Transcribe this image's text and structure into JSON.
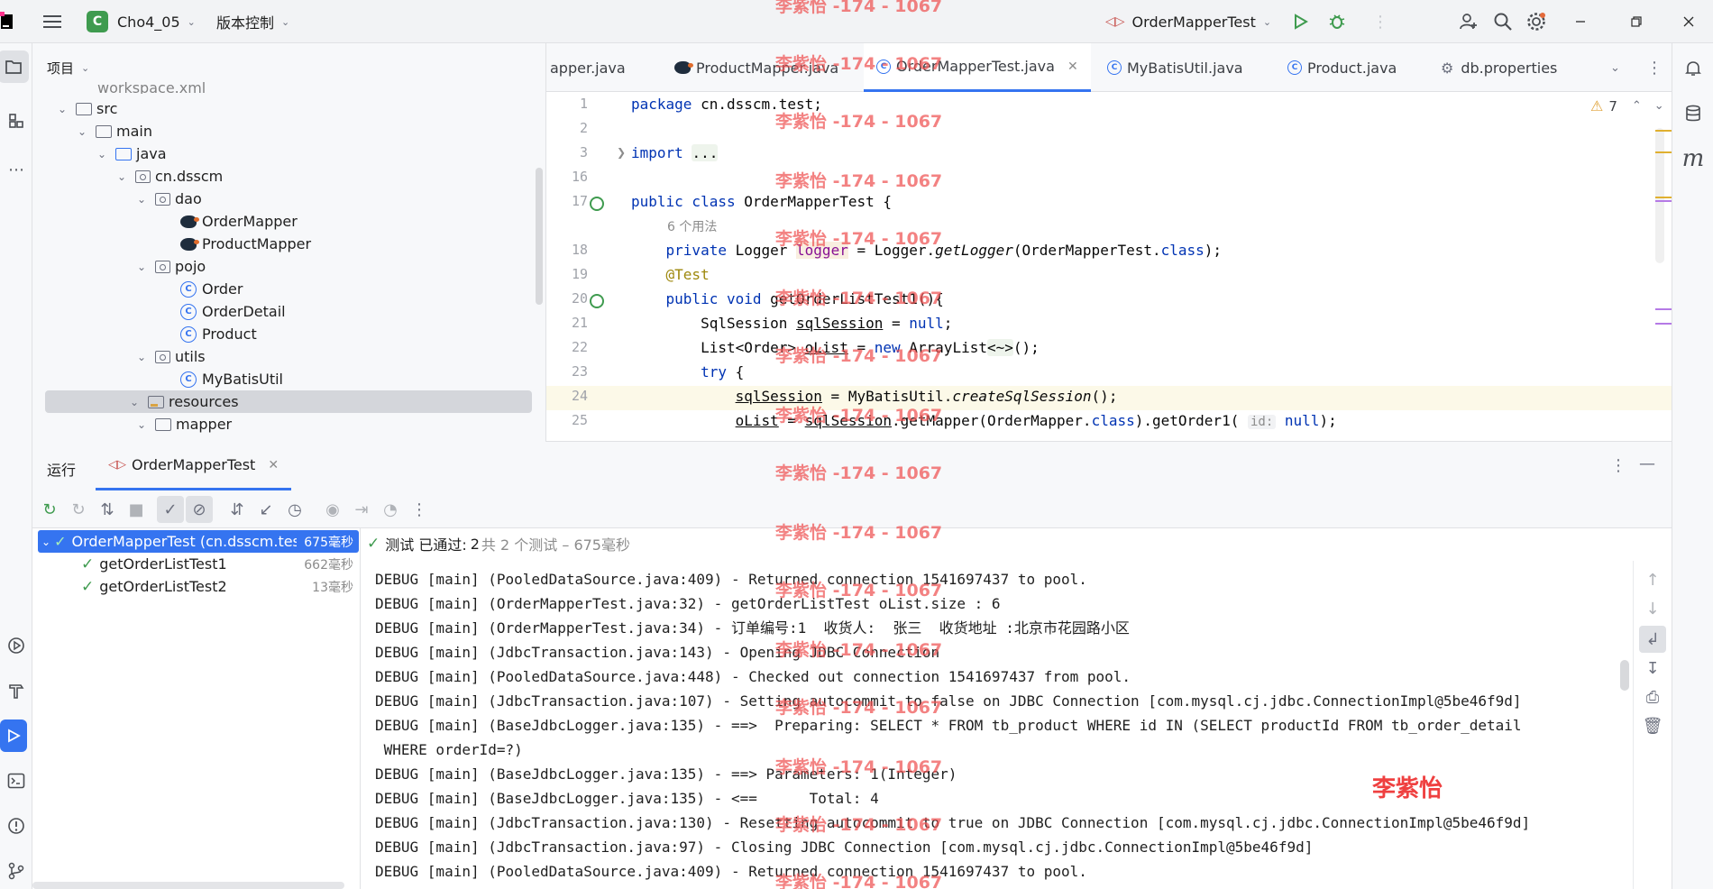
{
  "titlebar": {
    "project_badge": "C",
    "project_name": "Cho4_05",
    "vcs": "版本控制",
    "run_config": "OrderMapperTest"
  },
  "project_panel": {
    "title": "项目",
    "tree": [
      {
        "label": "workspace.xml",
        "icon": "file-icon"
      },
      {
        "label": "src",
        "icon": "folder-icon"
      },
      {
        "label": "main",
        "icon": "folder-icon"
      },
      {
        "label": "java",
        "icon": "folder-icon"
      },
      {
        "label": "cn.dsscm",
        "icon": "package-icon"
      },
      {
        "label": "dao",
        "icon": "package-icon"
      },
      {
        "label": "OrderMapper",
        "icon": "mapper-icon"
      },
      {
        "label": "ProductMapper",
        "icon": "mapper-icon"
      },
      {
        "label": "pojo",
        "icon": "package-icon"
      },
      {
        "label": "Order",
        "icon": "class-icon"
      },
      {
        "label": "OrderDetail",
        "icon": "class-icon"
      },
      {
        "label": "Product",
        "icon": "class-icon"
      },
      {
        "label": "utils",
        "icon": "package-icon"
      },
      {
        "label": "MyBatisUtil",
        "icon": "class-icon"
      },
      {
        "label": "resources",
        "icon": "resources-folder-icon"
      },
      {
        "label": "mapper",
        "icon": "folder-icon"
      }
    ]
  },
  "editor_tabs": [
    {
      "label": "apper.java"
    },
    {
      "label": "ProductMapper.java"
    },
    {
      "label": "OrderMapperTest.java",
      "active": true
    },
    {
      "label": "MyBatisUtil.java"
    },
    {
      "label": "Product.java"
    },
    {
      "label": "db.properties"
    }
  ],
  "editor": {
    "warnings": "7",
    "line_numbers": [
      "1",
      "2",
      "3",
      "16",
      "17",
      "",
      "18",
      "19",
      "20",
      "21",
      "22",
      "23",
      "24",
      "25"
    ],
    "usage_hint": "6 个用法",
    "folded": "...",
    "param_hint": "id:"
  },
  "run_panel": {
    "tab_run": "运行",
    "tab_config": "OrderMapperTest",
    "tests": [
      {
        "name": "OrderMapperTest (cn.dsscm.tes",
        "duration": "675毫秒"
      },
      {
        "name": "getOrderListTest1",
        "duration": "662毫秒"
      },
      {
        "name": "getOrderListTest2",
        "duration": "13毫秒"
      }
    ],
    "status_label": "测试 已通过:",
    "status_count": "2",
    "status_detail": "共 2 个测试 – 675毫秒",
    "console": [
      "DEBUG [main] (PooledDataSource.java:409) - Returned connection 1541697437 to pool.",
      "DEBUG [main] (OrderMapperTest.java:32) - getOrderListTest oList.size : 6",
      "DEBUG [main] (OrderMapperTest.java:34) - 订单编号:1  收货人:  张三  收货地址 :北京市花园路小区",
      "DEBUG [main] (JdbcTransaction.java:143) - Opening JDBC Connection",
      "DEBUG [main] (PooledDataSource.java:448) - Checked out connection 1541697437 from pool.",
      "DEBUG [main] (JdbcTransaction.java:107) - Setting autocommit to false on JDBC Connection [com.mysql.cj.jdbc.ConnectionImpl@5be46f9d]",
      "DEBUG [main] (BaseJdbcLogger.java:135) - ==>  Preparing: SELECT * FROM tb_product WHERE id IN (SELECT productId FROM tb_order_detail",
      " WHERE orderId=?)",
      "DEBUG [main] (BaseJdbcLogger.java:135) - ==> Parameters: 1(Integer)",
      "DEBUG [main] (BaseJdbcLogger.java:135) - <==      Total: 4",
      "DEBUG [main] (JdbcTransaction.java:130) - Resetting autocommit to true on JDBC Connection [com.mysql.cj.jdbc.ConnectionImpl@5be46f9d]",
      "DEBUG [main] (JdbcTransaction.java:97) - Closing JDBC Connection [com.mysql.cj.jdbc.ConnectionImpl@5be46f9d]",
      "DEBUG [main] (PooledDataSource.java:409) - Returned connection 1541697437 to pool."
    ]
  },
  "watermark": {
    "text": "李紫怡 -174 - 1067",
    "signature": "李紫怡"
  },
  "colors": {
    "accent": "#3574f0",
    "success": "#3f9b4f",
    "keyword": "#0033b3",
    "watermark": "#ef5353"
  }
}
